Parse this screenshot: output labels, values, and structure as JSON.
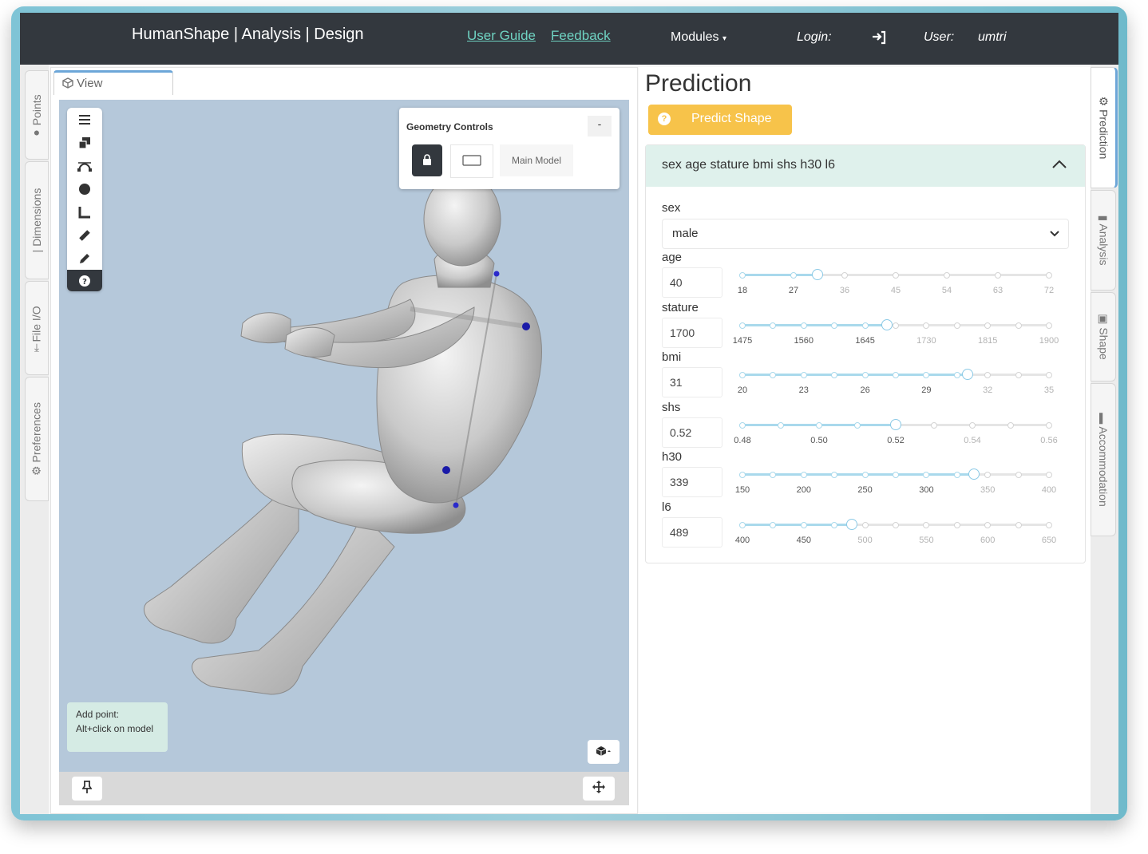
{
  "navbar": {
    "brand": "HumanShape | Analysis | Design",
    "links": [
      "User Guide",
      "Feedback"
    ],
    "modules_label": "Modules",
    "login_label": "Login:",
    "user_label": "User:",
    "user_name": "umtri"
  },
  "left_tabs": [
    "Points",
    "Dimensions",
    "File I/O",
    "Preferences"
  ],
  "view": {
    "tab_label": "View",
    "geometry_controls": {
      "title": "Geometry Controls",
      "collapse_label": "-",
      "model_label": "Main Model"
    },
    "hint": {
      "line1": "Add point:",
      "line2": "Alt+click on model"
    },
    "toolbar_icons": [
      "menu-icon",
      "layers-icon",
      "bezier-icon",
      "sphere-icon",
      "angle-icon",
      "ruler-icon",
      "pencil-icon",
      "help-icon"
    ]
  },
  "prediction": {
    "title": "Prediction",
    "predict_button": "Predict Shape",
    "accordion_title": "sex age stature bmi shs h30 l6",
    "sex": {
      "label": "sex",
      "value": "male"
    },
    "fields": [
      {
        "label": "age",
        "value": "40",
        "position": 0.2444,
        "ticks": [
          "18",
          "27",
          "36",
          "45",
          "54",
          "63",
          "72"
        ]
      },
      {
        "label": "stature",
        "value": "1700",
        "position": 0.4706,
        "ticks": [
          "1475",
          "1560",
          "1645",
          "1730",
          "1815",
          "1900"
        ]
      },
      {
        "label": "bmi",
        "value": "31",
        "position": 0.7333,
        "ticks": [
          "20",
          "23",
          "26",
          "29",
          "32",
          "35"
        ]
      },
      {
        "label": "shs",
        "value": "0.52",
        "position": 0.5,
        "ticks": [
          "0.48",
          "0.50",
          "0.52",
          "0.54",
          "0.56"
        ]
      },
      {
        "label": "h30",
        "value": "339",
        "position": 0.756,
        "ticks": [
          "150",
          "200",
          "250",
          "300",
          "350",
          "400"
        ]
      },
      {
        "label": "l6",
        "value": "489",
        "position": 0.356,
        "ticks": [
          "400",
          "450",
          "500",
          "550",
          "600",
          "650"
        ]
      }
    ]
  },
  "right_tabs": [
    "Prediction",
    "Analysis",
    "Shape",
    "Accommodation"
  ],
  "colors": {
    "navbar": "#33383e",
    "link": "#6fd3c2",
    "accent_button": "#f7c34a",
    "accordion_header": "#dff1ec",
    "viewport": "#b5c8da",
    "slider_fill": "#a9d9ec"
  }
}
